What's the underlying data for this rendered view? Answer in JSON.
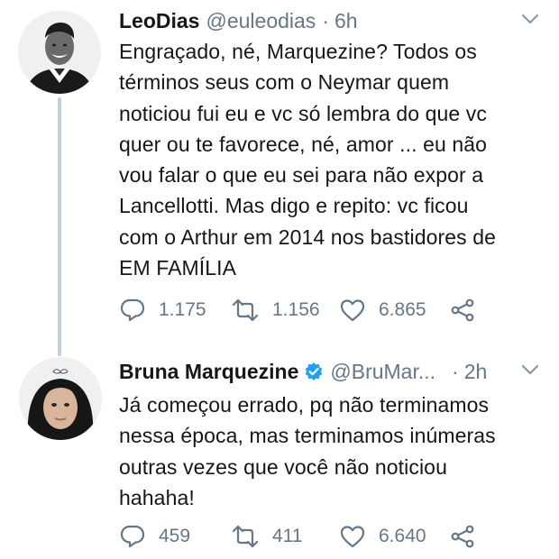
{
  "tweets": [
    {
      "name": "LeoDias",
      "handle": "@euleodias",
      "separator": "·",
      "time": "6h",
      "verified": false,
      "text_lines": [
        "Engraçado, né, Marquezine? Todos os",
        "términos seus com o Neymar quem",
        "noticiou fui eu e vc só lembra do que vc",
        "quer ou te favorece, né, amor ... eu não",
        "vou falar o que eu sei para não expor a",
        "Lancellotti. Mas digo e repito: vc ficou",
        "com o Arthur em 2014 nos bastidores de",
        "EM FAMÍLIA"
      ],
      "replies": "1.175",
      "retweets": "1.156",
      "likes": "6.865"
    },
    {
      "name": "Bruna Marquezine",
      "handle": "@BruMar...",
      "separator": "·",
      "time": "2h",
      "verified": true,
      "text_lines": [
        "Já começou errado, pq não terminamos",
        "nessa época, mas terminamos inúmeras",
        "outras vezes que você não noticiou",
        "hahaha!"
      ],
      "replies": "459",
      "retweets": "411",
      "likes": "6.640"
    }
  ],
  "icons": {
    "reply": "reply-icon",
    "retweet": "retweet-icon",
    "like": "heart-icon",
    "share": "share-icon",
    "more": "chevron-down-icon",
    "verified": "verified-badge-icon"
  },
  "colors": {
    "text": "#14171a",
    "secondary": "#657786",
    "verified": "#1da1f2",
    "thread_line": "#c4cfd6"
  }
}
